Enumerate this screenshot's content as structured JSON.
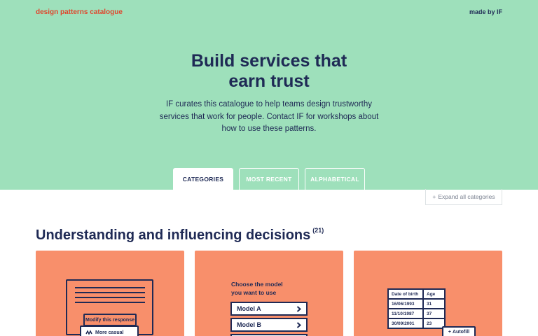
{
  "header": {
    "brand": "design patterns catalogue",
    "made_by": "made by IF"
  },
  "hero": {
    "title_line1": "Build services that",
    "title_line2": "earn trust",
    "description": "IF curates this catalogue to help teams design trustworthy services that work for people. Contact IF for workshops about how to use these patterns."
  },
  "tabs": [
    {
      "label": "CATEGORIES",
      "active": true
    },
    {
      "label": "MOST RECENT",
      "active": false
    },
    {
      "label": "ALPHABETICAL",
      "active": false
    }
  ],
  "expand_button": {
    "icon": "plus-icon",
    "label": "Expand all categories"
  },
  "section": {
    "title": "Understanding and influencing decisions",
    "count": "(21)"
  },
  "cards": {
    "modify": {
      "modify_label": "Modify this response",
      "casual_label": "More casual",
      "casual_icon": "wave-icon"
    },
    "choose_model": {
      "prompt_line1": "Choose the model",
      "prompt_line2": "you want to use",
      "options": [
        "Model A",
        "Model B"
      ],
      "option_icon": "chevron-right-icon"
    },
    "autofill": {
      "headers": [
        "Date of birth",
        "Age"
      ],
      "rows": [
        [
          "16/06/1993",
          "31"
        ],
        [
          "11/10/1987",
          "37"
        ],
        [
          "30/09/2001",
          "23"
        ]
      ],
      "button_label": "Autofill",
      "button_icon": "plus-icon"
    }
  },
  "colors": {
    "hero_bg": "#9ee0bb",
    "brand_red": "#e0452c",
    "navy": "#1f2a55",
    "card_bg": "#f88f6b"
  }
}
